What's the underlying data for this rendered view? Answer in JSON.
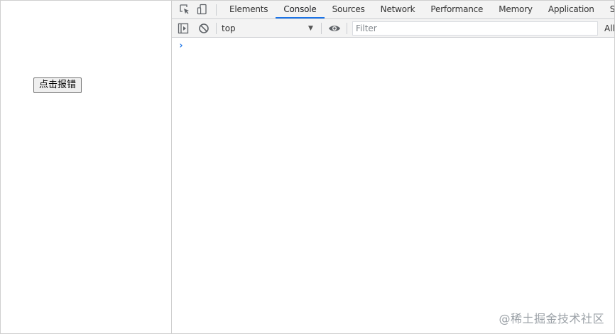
{
  "page": {
    "report_button_label": "点击报错"
  },
  "devtools": {
    "tabs": [
      {
        "label": "Elements",
        "active": false
      },
      {
        "label": "Console",
        "active": true
      },
      {
        "label": "Sources",
        "active": false
      },
      {
        "label": "Network",
        "active": false
      },
      {
        "label": "Performance",
        "active": false
      },
      {
        "label": "Memory",
        "active": false
      },
      {
        "label": "Application",
        "active": false
      },
      {
        "label": "Secur",
        "active": false
      }
    ],
    "console": {
      "context_value": "top",
      "filter_placeholder": "Filter",
      "levels_label": "All",
      "prompt_symbol": "›"
    }
  },
  "watermark": "@稀土掘金技术社区",
  "colors": {
    "accent": "#1a73e8",
    "toolbar_bg": "#f3f3f3",
    "border": "#cbcdd1"
  },
  "icons": {
    "inspect": "inspect-element-icon",
    "device": "device-toolbar-icon",
    "sidebar": "console-sidebar-icon",
    "clear": "clear-console-icon",
    "eye": "live-expression-eye-icon"
  }
}
